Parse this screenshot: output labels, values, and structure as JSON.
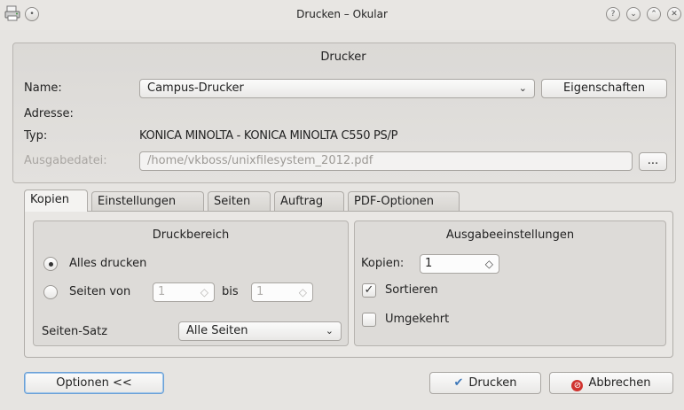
{
  "window": {
    "title": "Drucken – Okular"
  },
  "printer": {
    "section_title": "Drucker",
    "name_label": "Name:",
    "name_value": "Campus-Drucker",
    "properties_button": "Eigenschaften",
    "address_label": "Adresse:",
    "type_label": "Typ:",
    "type_value": "KONICA MINOLTA - KONICA MINOLTA C550 PS/P",
    "output_file_label": "Ausgabedatei:",
    "output_file_value": "/home/vkboss/unixfilesystem_2012.pdf",
    "browse_button": "..."
  },
  "tabs": [
    {
      "label": "Kopien"
    },
    {
      "label": "Einstellungen"
    },
    {
      "label": "Seiten"
    },
    {
      "label": "Auftrag"
    },
    {
      "label": "PDF-Optionen"
    }
  ],
  "print_range": {
    "title": "Druckbereich",
    "all_pages": "Alles drucken",
    "pages_from": "Seiten von",
    "from_value": "1",
    "to_label": "bis",
    "to_value": "1",
    "page_set_label": "Seiten-Satz",
    "page_set_value": "Alle Seiten"
  },
  "output_settings": {
    "title": "Ausgabeeinstellungen",
    "copies_label": "Kopien:",
    "copies_value": "1",
    "collate_label": "Sortieren",
    "reverse_label": "Umgekehrt"
  },
  "footer": {
    "options_button": "Optionen <<",
    "print_button": "Drucken",
    "cancel_button": "Abbrechen"
  }
}
